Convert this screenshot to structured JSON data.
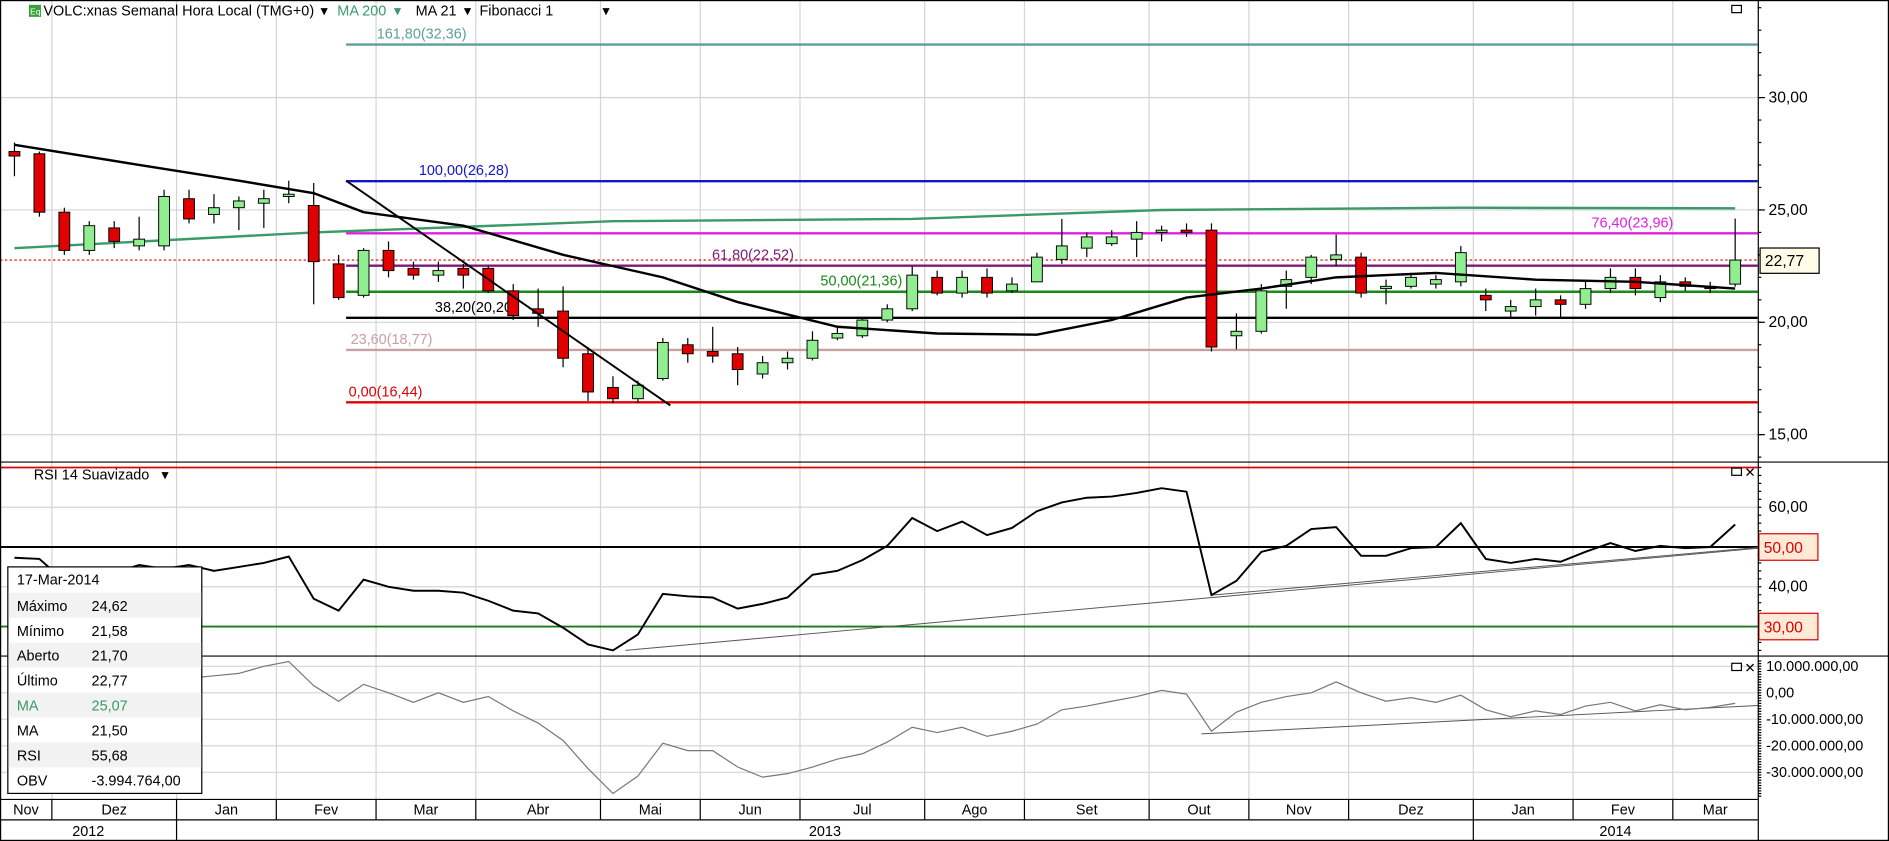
{
  "header": {
    "icon_label": "Eq",
    "title": "VOLC:xnas Semanal Hora Local (TMG+0)",
    "indicators": [
      {
        "label": "MA 200",
        "color": "#3a9a6a"
      },
      {
        "label": "MA 21",
        "color": "#000000"
      },
      {
        "label": "Fibonacci 1",
        "color": "#000000"
      }
    ],
    "dropdown_icon": "caret-down-icon"
  },
  "rsi_pane": {
    "title": "RSI 14 Suavizado"
  },
  "info_box": {
    "date": "17-Mar-2014",
    "rows": [
      {
        "label": "Máximo",
        "value": "24,62",
        "color": "#000000"
      },
      {
        "label": "Mínimo",
        "value": "21,58",
        "color": "#000000"
      },
      {
        "label": "Aberto",
        "value": "21,70",
        "color": "#000000"
      },
      {
        "label": "Último",
        "value": "22,77",
        "color": "#000000"
      },
      {
        "label": "MA",
        "value": "25,07",
        "color": "#3a9a6a"
      },
      {
        "label": "MA",
        "value": "21,50",
        "color": "#000000"
      },
      {
        "label": "RSI",
        "value": "55,68",
        "color": "#000000"
      },
      {
        "label": "OBV",
        "value": "-3.994.764,00",
        "color": "#000000"
      }
    ]
  },
  "axes": {
    "price_ticks": [
      {
        "value": 30,
        "label": "30,00"
      },
      {
        "value": 25,
        "label": "25,00"
      },
      {
        "value": 20,
        "label": "20,00"
      },
      {
        "value": 15,
        "label": "15,00"
      }
    ],
    "last_price": {
      "value": 22.77,
      "label": "22,77",
      "color": "#e00000"
    },
    "rsi_ticks": [
      {
        "value": 60,
        "label": "60,00"
      },
      {
        "value": 40,
        "label": "40,00"
      }
    ],
    "rsi_levels": [
      {
        "value": 70,
        "color": "#e00000",
        "tag": ""
      },
      {
        "value": 50,
        "color": "#000000",
        "tag": "50,00"
      },
      {
        "value": 30,
        "color": "#1a7a1a",
        "tag": "30,00"
      }
    ],
    "obv_ticks": [
      {
        "value": 10000000,
        "label": "10.000.000,00"
      },
      {
        "value": 0,
        "label": "0,00"
      },
      {
        "value": -10000000,
        "label": "-10.000.000,00"
      },
      {
        "value": -20000000,
        "label": "-20.000.000,00"
      },
      {
        "value": -30000000,
        "label": "-30.000.000,00"
      }
    ]
  },
  "time_axis": {
    "months": [
      {
        "label": "Nov",
        "weeks": 2
      },
      {
        "label": "Dez",
        "weeks": 5
      },
      {
        "label": "Jan",
        "weeks": 4
      },
      {
        "label": "Fev",
        "weeks": 4
      },
      {
        "label": "Mar",
        "weeks": 4
      },
      {
        "label": "Abr",
        "weeks": 5
      },
      {
        "label": "Mai",
        "weeks": 4
      },
      {
        "label": "Jun",
        "weeks": 4
      },
      {
        "label": "Jul",
        "weeks": 5
      },
      {
        "label": "Ago",
        "weeks": 4
      },
      {
        "label": "Set",
        "weeks": 5
      },
      {
        "label": "Out",
        "weeks": 4
      },
      {
        "label": "Nov",
        "weeks": 4
      },
      {
        "label": "Dez",
        "weeks": 5
      },
      {
        "label": "Jan",
        "weeks": 4
      },
      {
        "label": "Fev",
        "weeks": 4
      },
      {
        "label": "Mar",
        "weeks": 3
      }
    ],
    "years": [
      {
        "label": "2012",
        "weeks": 7
      },
      {
        "label": "2013",
        "weeks": 52
      },
      {
        "label": "2014",
        "weeks": 11
      }
    ]
  },
  "chart_data": {
    "type": "candlestick",
    "title": "VOLC:xnas Semanal",
    "interval": "weekly",
    "price_range": [
      13.5,
      34.5
    ],
    "up_color": "#90ee90",
    "down_color": "#e00000",
    "candles_ohlc": [
      [
        27.6,
        28.0,
        26.5,
        27.4
      ],
      [
        27.5,
        27.6,
        24.7,
        24.9
      ],
      [
        24.9,
        25.1,
        23.0,
        23.2
      ],
      [
        23.2,
        24.5,
        23.0,
        24.3
      ],
      [
        24.2,
        24.5,
        23.3,
        23.6
      ],
      [
        23.4,
        24.7,
        23.2,
        23.7
      ],
      [
        23.4,
        25.9,
        23.2,
        25.6
      ],
      [
        25.5,
        25.9,
        24.4,
        24.6
      ],
      [
        24.8,
        25.7,
        24.4,
        25.1
      ],
      [
        25.1,
        25.6,
        24.1,
        25.4
      ],
      [
        25.3,
        25.9,
        24.2,
        25.5
      ],
      [
        25.6,
        26.3,
        25.3,
        25.7
      ],
      [
        25.2,
        26.2,
        20.8,
        22.7
      ],
      [
        22.6,
        23.0,
        21.0,
        21.1
      ],
      [
        21.2,
        23.3,
        21.1,
        23.2
      ],
      [
        23.2,
        23.6,
        22.0,
        22.3
      ],
      [
        22.4,
        22.7,
        21.9,
        22.1
      ],
      [
        22.1,
        22.7,
        21.8,
        22.3
      ],
      [
        22.4,
        22.6,
        21.5,
        22.1
      ],
      [
        22.4,
        22.5,
        21.3,
        21.4
      ],
      [
        21.4,
        21.7,
        20.1,
        20.3
      ],
      [
        20.6,
        21.5,
        19.8,
        20.4
      ],
      [
        20.5,
        21.6,
        18.0,
        18.4
      ],
      [
        18.6,
        18.9,
        16.5,
        16.9
      ],
      [
        17.1,
        17.6,
        16.4,
        16.6
      ],
      [
        16.6,
        17.4,
        16.4,
        17.2
      ],
      [
        17.5,
        19.3,
        17.4,
        19.1
      ],
      [
        19.0,
        19.3,
        18.2,
        18.6
      ],
      [
        18.7,
        19.8,
        18.2,
        18.5
      ],
      [
        18.6,
        18.9,
        17.2,
        17.9
      ],
      [
        17.7,
        18.5,
        17.5,
        18.2
      ],
      [
        18.2,
        18.7,
        17.9,
        18.4
      ],
      [
        18.4,
        19.6,
        18.3,
        19.2
      ],
      [
        19.3,
        19.8,
        19.2,
        19.5
      ],
      [
        19.4,
        20.2,
        19.3,
        20.1
      ],
      [
        20.1,
        20.8,
        20.0,
        20.6
      ],
      [
        20.6,
        22.5,
        20.5,
        22.1
      ],
      [
        22.0,
        22.3,
        21.2,
        21.3
      ],
      [
        21.3,
        22.3,
        21.1,
        22.0
      ],
      [
        22.0,
        22.4,
        21.1,
        21.3
      ],
      [
        21.4,
        22.0,
        21.3,
        21.7
      ],
      [
        21.8,
        23.1,
        21.8,
        22.9
      ],
      [
        22.8,
        24.6,
        22.6,
        23.4
      ],
      [
        23.3,
        24.0,
        22.9,
        23.8
      ],
      [
        23.5,
        24.1,
        23.4,
        23.8
      ],
      [
        23.7,
        24.5,
        22.9,
        24.0
      ],
      [
        24.0,
        24.3,
        23.6,
        24.1
      ],
      [
        24.1,
        24.4,
        23.8,
        24.0
      ],
      [
        24.1,
        24.4,
        18.7,
        18.9
      ],
      [
        19.4,
        20.4,
        18.8,
        19.6
      ],
      [
        19.6,
        21.7,
        19.5,
        21.4
      ],
      [
        21.6,
        22.3,
        20.6,
        21.9
      ],
      [
        22.0,
        23.0,
        21.7,
        22.9
      ],
      [
        22.8,
        23.9,
        22.5,
        23.0
      ],
      [
        22.9,
        23.1,
        21.1,
        21.3
      ],
      [
        21.5,
        21.9,
        20.8,
        21.6
      ],
      [
        21.6,
        22.2,
        21.5,
        22.0
      ],
      [
        21.7,
        22.1,
        21.5,
        21.9
      ],
      [
        21.8,
        23.4,
        21.6,
        23.1
      ],
      [
        21.2,
        21.5,
        20.5,
        21.0
      ],
      [
        20.5,
        21.0,
        20.2,
        20.7
      ],
      [
        20.7,
        21.5,
        20.3,
        21.0
      ],
      [
        21.0,
        21.2,
        20.2,
        20.8
      ],
      [
        20.8,
        21.9,
        20.6,
        21.5
      ],
      [
        21.5,
        22.4,
        21.3,
        22.0
      ],
      [
        22.0,
        22.4,
        21.2,
        21.5
      ],
      [
        21.1,
        22.1,
        20.9,
        21.8
      ],
      [
        21.8,
        22.0,
        21.4,
        21.6
      ],
      [
        21.6,
        21.8,
        21.3,
        21.5
      ],
      [
        21.7,
        24.62,
        21.58,
        22.77
      ]
    ],
    "ma200": {
      "label": "MA 200",
      "color": "#3a9a6a",
      "points": [
        [
          0,
          23.3
        ],
        [
          12,
          24.0
        ],
        [
          24,
          24.5
        ],
        [
          36,
          24.6
        ],
        [
          46,
          25.0
        ],
        [
          58,
          25.1
        ],
        [
          69,
          25.07
        ]
      ]
    },
    "ma21": {
      "label": "MA 21",
      "color": "#000000",
      "points": [
        [
          0,
          27.9
        ],
        [
          5,
          27.0
        ],
        [
          9,
          26.3
        ],
        [
          12,
          25.75
        ],
        [
          14,
          24.9
        ],
        [
          18,
          24.3
        ],
        [
          22,
          23.0
        ],
        [
          26,
          22.0
        ],
        [
          29,
          20.9
        ],
        [
          33,
          19.8
        ],
        [
          37,
          19.5
        ],
        [
          41,
          19.45
        ],
        [
          44,
          20.1
        ],
        [
          47,
          21.1
        ],
        [
          50,
          21.5
        ],
        [
          53,
          22.0
        ],
        [
          57,
          22.2
        ],
        [
          61,
          21.9
        ],
        [
          65,
          21.8
        ],
        [
          69,
          21.5
        ]
      ]
    },
    "trendline": {
      "from": [
        13.3,
        26.3
      ],
      "to": [
        26.3,
        16.3
      ]
    },
    "fibonacci": [
      {
        "level": "161,80",
        "price": 32.36,
        "label": "161,80(32,36)",
        "color": "#5f9e98"
      },
      {
        "level": "100,00",
        "price": 26.28,
        "label": "100,00(26,28)",
        "color": "#1414c8"
      },
      {
        "level": "76,40",
        "price": 23.96,
        "label": "76,40(23,96)",
        "color": "#e020e0"
      },
      {
        "level": "61,80",
        "price": 22.52,
        "label": "61,80(22,52)",
        "color": "#7a1a7a"
      },
      {
        "level": "50,00",
        "price": 21.36,
        "label": "50,00(21,36)",
        "color": "#1a8a1a"
      },
      {
        "level": "38,20",
        "price": 20.2,
        "label": "38,20(20,20)",
        "color": "#000000"
      },
      {
        "level": "23,60",
        "price": 18.77,
        "label": "23,60(18,77)",
        "color": "#c8a0a0"
      },
      {
        "level": "0,00",
        "price": 16.44,
        "label": "0,00(16,44)",
        "color": "#e00000"
      }
    ],
    "fib_start_index": 13.3,
    "rsi": {
      "label": "RSI 14 Suavizado",
      "range": [
        15,
        75
      ],
      "values": [
        47.3,
        47,
        41.5,
        42,
        43.5,
        45.5,
        44.5,
        45.5,
        44,
        45,
        46,
        47.6,
        37,
        34,
        41.8,
        40,
        39,
        39,
        38.5,
        36.5,
        34,
        33.3,
        29.7,
        25.5,
        24,
        28,
        38.2,
        37.6,
        37.3,
        34.5,
        35.7,
        37.3,
        43,
        44,
        46.7,
        50.3,
        57.3,
        54,
        56.4,
        53,
        54.8,
        59,
        61.2,
        62.4,
        62.7,
        63.6,
        64.8,
        63.9,
        37.9,
        41.5,
        48.8,
        50.3,
        54.5,
        55,
        47.8,
        47.8,
        49.7,
        50,
        56,
        47,
        46,
        47,
        46.3,
        48.8,
        51,
        49,
        50.3,
        49.7,
        50,
        55.68
      ],
      "trendlines": [
        {
          "from": [
            24.5,
            24
          ],
          "to": [
            70.5,
            50
          ]
        },
        {
          "from": [
            48,
            37.9
          ],
          "to": [
            70.5,
            50.2
          ]
        }
      ]
    },
    "obv": {
      "label": "OBV",
      "range": [
        -40000000,
        12000000
      ],
      "values_millions": [
        4.5,
        4.3,
        -3.6,
        0,
        -1.8,
        0.5,
        3.2,
        5.5,
        6.4,
        7.3,
        10,
        11.8,
        2.7,
        -3.2,
        3.2,
        0,
        -3.6,
        0,
        -3.6,
        -1.4,
        -6.8,
        -11.4,
        -18,
        -28.6,
        -38,
        -31.4,
        -19,
        -21.8,
        -21.8,
        -28,
        -31.8,
        -30.5,
        -28,
        -25,
        -23,
        -18.6,
        -13,
        -15,
        -13,
        -16.4,
        -14.5,
        -11.8,
        -6.4,
        -5,
        -3.2,
        -1.4,
        0.9,
        -0.5,
        -14.5,
        -7.3,
        -3.6,
        -1.4,
        0,
        4.1,
        0,
        -3.2,
        -1.8,
        -3.6,
        -0.9,
        -6.4,
        -9,
        -6.8,
        -8.2,
        -5,
        -3.6,
        -6.8,
        -4.5,
        -6.4,
        -5.5,
        -3.99
      ],
      "trendline": {
        "from": [
          47.6,
          -15.5
        ],
        "to": [
          70.5,
          -4.5
        ]
      }
    }
  }
}
